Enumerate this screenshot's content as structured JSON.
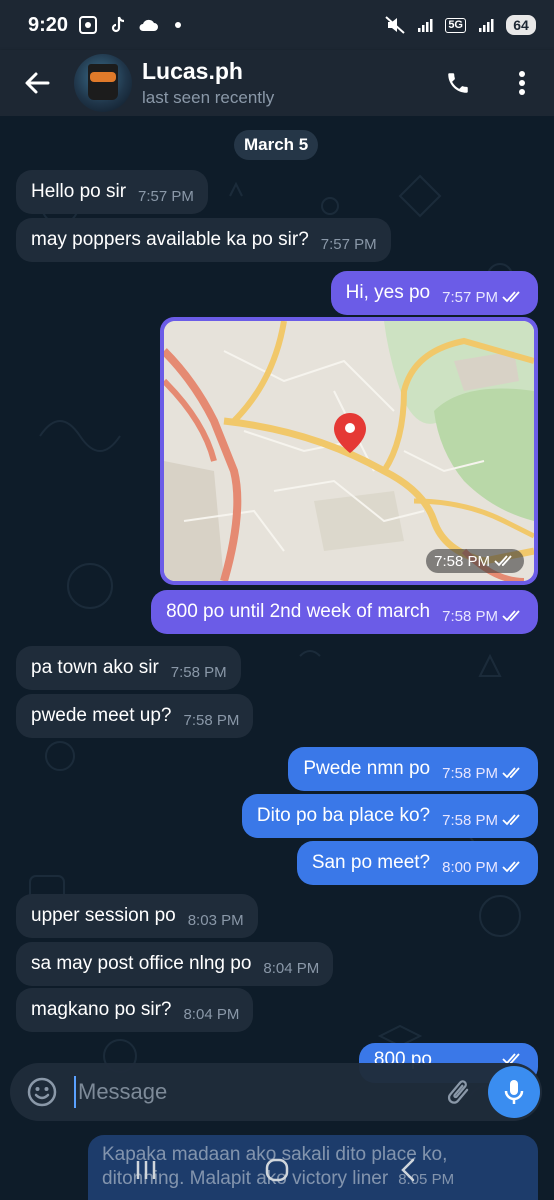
{
  "status": {
    "time": "9:20",
    "network": "5G",
    "battery": "64"
  },
  "header": {
    "title": "Lucas.ph",
    "subtitle": "last seen recently"
  },
  "date_chip": "March 5",
  "messages": [
    {
      "dir": "in",
      "text": "Hello po sir",
      "time": "7:57 PM"
    },
    {
      "dir": "in",
      "text": "may poppers available ka po sir?",
      "time": "7:57 PM"
    },
    {
      "dir": "out",
      "text": "Hi, yes po",
      "time": "7:57 PM"
    },
    {
      "dir": "out",
      "type": "location",
      "time": "7:58 PM"
    },
    {
      "dir": "out",
      "text": "800 po until 2nd week of march",
      "time": "7:58 PM"
    },
    {
      "dir": "in",
      "text": "pa town ako sir",
      "time": "7:58 PM"
    },
    {
      "dir": "in",
      "text": "pwede meet up?",
      "time": "7:58 PM"
    },
    {
      "dir": "out",
      "text": "Pwede nmn po",
      "time": "7:58 PM"
    },
    {
      "dir": "out",
      "text": "Dito po ba place ko?",
      "time": "7:58 PM"
    },
    {
      "dir": "out",
      "text": "San po meet?",
      "time": "8:00 PM"
    },
    {
      "dir": "in",
      "text": "upper session po",
      "time": "8:03 PM"
    },
    {
      "dir": "in",
      "text": "sa may post office nlng po",
      "time": "8:04 PM"
    },
    {
      "dir": "in",
      "text": "magkano po sir?",
      "time": "8:04 PM"
    },
    {
      "dir": "out",
      "text": "800 po",
      "time": ""
    }
  ],
  "partial_message": {
    "line1": "Kapaka madaan ako sakali dito place ko,",
    "line2": "ditonning. Malapit ako victory liner",
    "time": "8:05 PM"
  },
  "composer": {
    "placeholder": "Message"
  },
  "icons": {
    "back": "arrow-left-icon",
    "call": "phone-icon",
    "menu": "more-vertical-icon",
    "emoji": "emoji-icon",
    "attach": "paperclip-icon",
    "mic": "microphone-icon",
    "read": "double-check-icon"
  },
  "colors": {
    "outgoing_purple": "#6b5ce7",
    "outgoing_blue": "#3a78e8",
    "incoming": "#1f2c3a",
    "header": "#1d2733",
    "accent": "#3a8df0"
  }
}
